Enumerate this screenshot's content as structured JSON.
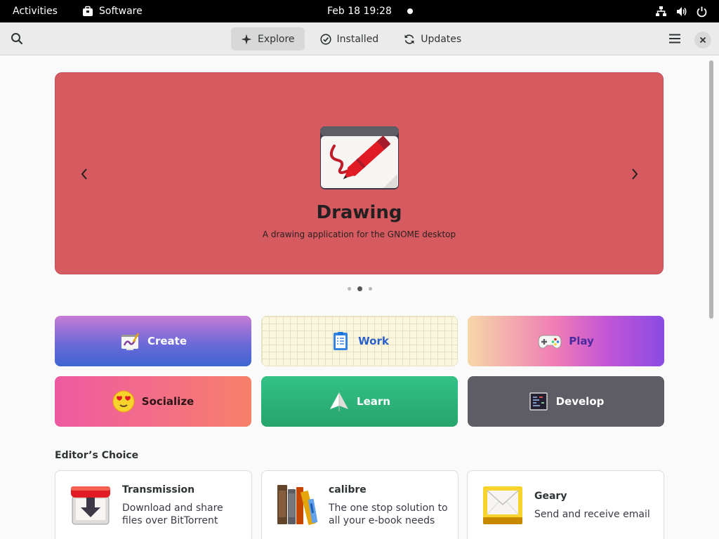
{
  "topbar": {
    "activities": "Activities",
    "app_name": "Software",
    "clock": "Feb 18  19:28"
  },
  "header": {
    "tabs": [
      {
        "label": "Explore",
        "icon": "explore-icon",
        "active": true
      },
      {
        "label": "Installed",
        "icon": "check-circle-icon",
        "active": false
      },
      {
        "label": "Updates",
        "icon": "refresh-icon",
        "active": false
      }
    ]
  },
  "hero": {
    "title": "Drawing",
    "subtitle": "A drawing application for the GNOME desktop",
    "background": "#d55b61",
    "page_index": 1,
    "page_count": 3
  },
  "categories": [
    {
      "label": "Create",
      "icon": "create-icon"
    },
    {
      "label": "Work",
      "icon": "work-icon"
    },
    {
      "label": "Play",
      "icon": "gamepad-icon"
    },
    {
      "label": "Socialize",
      "icon": "heart-eyes-emoji-icon"
    },
    {
      "label": "Learn",
      "icon": "paper-plane-icon"
    },
    {
      "label": "Develop",
      "icon": "terminal-icon"
    }
  ],
  "editors_choice": {
    "title": "Editor’s Choice",
    "apps": [
      {
        "name": "Transmission",
        "description": "Download and share files over BitTorrent",
        "icon": "transmission-icon"
      },
      {
        "name": "calibre",
        "description": "The one stop solution to all your e-book needs",
        "icon": "calibre-books-icon"
      },
      {
        "name": "Geary",
        "description": "Send and receive email",
        "icon": "geary-mail-icon"
      }
    ]
  }
}
